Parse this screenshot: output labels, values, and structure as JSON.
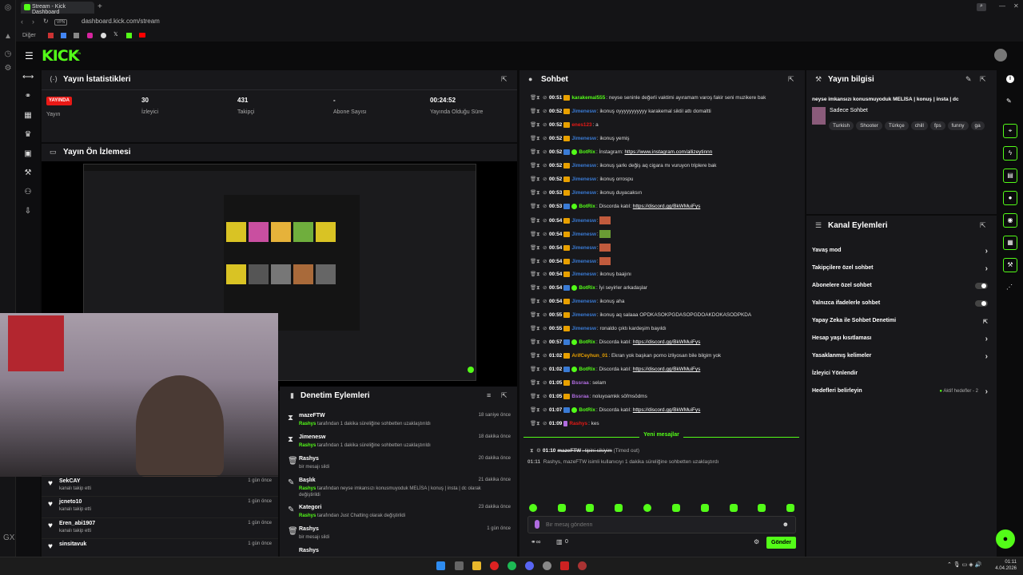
{
  "browser": {
    "tab_title": "Stream - Kick Dashboard",
    "url": "dashboard.kick.com/stream",
    "vpn": "VPN",
    "bookmarks_label": "Diğer"
  },
  "brand": {
    "logo": "KICK",
    "beta": "BETA",
    "accent": "#53fc18"
  },
  "stats": {
    "title": "Yayın İstatistikleri",
    "live_badge": "YAYINDA",
    "live_label": "Yayın",
    "viewers_val": "30",
    "viewers_lbl": "İzleyici",
    "followers_val": "431",
    "followers_lbl": "Takipçi",
    "subs_val": "-",
    "subs_lbl": "Abone Sayısı",
    "uptime_val": "00:24:52",
    "uptime_lbl": "Yayında Olduğu Süre"
  },
  "preview": {
    "title": "Yayın Ön İzlemesi"
  },
  "follows": [
    {
      "name": "SekCAY",
      "desc": "kanalı takip etti",
      "time": "1 gün önce"
    },
    {
      "name": "jcneto10",
      "desc": "kanalı takip etti",
      "time": "1 gün önce"
    },
    {
      "name": "Eren_abi1907",
      "desc": "kanalı takip etti",
      "time": "1 gün önce"
    },
    {
      "name": "sinsitavuk",
      "desc": "kanalı takip etti",
      "time": "1 gün önce"
    }
  ],
  "moderation": {
    "title": "Denetim Eylemleri",
    "rows": [
      {
        "name": "mazeFTW",
        "actor": "Rashys",
        "desc": " tarafından 1 dakika süreliğine sohbetten uzaklaştırıldı",
        "time": "18 saniye önce"
      },
      {
        "name": "Jimenesw",
        "actor": "Rashys",
        "desc": " tarafından 1 dakika süreliğine sohbetten uzaklaştırıldı",
        "time": "18 dakika önce"
      },
      {
        "name": "Rashys",
        "actor": "",
        "desc": "bir mesajı sildi",
        "time": "20 dakika önce"
      },
      {
        "name": "Başlık",
        "actor": "Rashys",
        "desc": " tarafından neyse imkansızı konusmuyoduk MELİSA | konuş | insta | dc olarak değiştirildi",
        "time": "21 dakika önce"
      },
      {
        "name": "Kategori",
        "actor": "Rashys",
        "desc": " tarafından Just Chatting olarak değiştirildi",
        "time": "23 dakika önce"
      },
      {
        "name": "Rashys",
        "actor": "",
        "desc": "bir mesajı sildi",
        "time": "1 gün önce"
      },
      {
        "name": "Rashys",
        "actor": "",
        "desc": "",
        "time": "1 gün önce"
      }
    ]
  },
  "chat": {
    "title": "Sohbet",
    "new_messages": "Yeni mesajlar",
    "placeholder": "Bir mesaj gönderin",
    "send": "Gönder",
    "count": "0",
    "messages": [
      {
        "ts": "00:51",
        "user": "karakemal555",
        "color": "#53fc18",
        "badge": "sub",
        "text": ": neyse seninle değerli vaktimi ayıramam varoş fakir seni muzikere bak"
      },
      {
        "ts": "00:52",
        "user": "Jimenesw",
        "color": "#3a7bd5",
        "badge": "sub",
        "text": ": ikonuş oyyyyyyyyyyy karakemal siktil attı domaltti"
      },
      {
        "ts": "00:52",
        "user": "enes123",
        "color": "#e91916",
        "badge": "sub",
        "text": ": a"
      },
      {
        "ts": "00:52",
        "user": "Jimenesw",
        "color": "#3a7bd5",
        "badge": "sub",
        "text": ": ikonuş yemiş"
      },
      {
        "ts": "00:52",
        "user": "BotRix",
        "color": "#53fc18",
        "badge": "bot",
        "text": ": İnstagram: ",
        "link": "https://www.instagram.com/allizeytinnn"
      },
      {
        "ts": "00:52",
        "user": "Jimenesw",
        "color": "#3a7bd5",
        "badge": "sub",
        "text": ": ikonuş şarkı değiş aq cigara mı vuruyon triplere bak"
      },
      {
        "ts": "00:52",
        "user": "Jimenesw",
        "color": "#3a7bd5",
        "badge": "sub",
        "text": ": ikonuş orrospu"
      },
      {
        "ts": "00:53",
        "user": "Jimenesw",
        "color": "#3a7bd5",
        "badge": "sub",
        "text": ": ikonuş duyacaksın"
      },
      {
        "ts": "00:53",
        "user": "BotRix",
        "color": "#53fc18",
        "badge": "bot",
        "text": ": Discorda katıl: ",
        "link": "https://discord.gg/BkWMuiFys"
      },
      {
        "ts": "00:54",
        "user": "Jimenesw",
        "color": "#3a7bd5",
        "badge": "sub",
        "text": ":",
        "emote": "red"
      },
      {
        "ts": "00:54",
        "user": "Jimenesw",
        "color": "#3a7bd5",
        "badge": "sub",
        "text": ":",
        "emote": "green"
      },
      {
        "ts": "00:54",
        "user": "Jimenesw",
        "color": "#3a7bd5",
        "badge": "sub",
        "text": ":",
        "emote": "red"
      },
      {
        "ts": "00:54",
        "user": "Jimenesw",
        "color": "#3a7bd5",
        "badge": "sub",
        "text": ":",
        "emote": "red"
      },
      {
        "ts": "00:54",
        "user": "Jimenesw",
        "color": "#3a7bd5",
        "badge": "sub",
        "text": ": ikonuş baajını"
      },
      {
        "ts": "00:54",
        "user": "BotRix",
        "color": "#53fc18",
        "badge": "bot",
        "text": ": İyi seyirler arkadaşlar"
      },
      {
        "ts": "00:54",
        "user": "Jimenesw",
        "color": "#3a7bd5",
        "badge": "sub",
        "text": ": ikonuş aha"
      },
      {
        "ts": "00:55",
        "user": "Jimenesw",
        "color": "#3a7bd5",
        "badge": "sub",
        "text": ": ikonuş aq salaaa OPDKASOKPGDASOPGDOAKDOKASODPKDA"
      },
      {
        "ts": "00:55",
        "user": "Jimenesw",
        "color": "#3a7bd5",
        "badge": "sub",
        "text": ": ronaldo çıktı kardeşim bayıldı"
      },
      {
        "ts": "00:57",
        "user": "BotRix",
        "color": "#53fc18",
        "badge": "bot",
        "text": ": Discorda katıl: ",
        "link": "https://discord.gg/BkWMuiFys"
      },
      {
        "ts": "01:02",
        "user": "ArifCeyhun_01",
        "color": "#e8a000",
        "badge": "sub",
        "text": ": Ekran yok başkan porno izliyosan bile bilgim yok"
      },
      {
        "ts": "01:02",
        "user": "BotRix",
        "color": "#53fc18",
        "badge": "bot",
        "text": ": Discorda katıl: ",
        "link": "https://discord.gg/BkWMuiFys"
      },
      {
        "ts": "01:05",
        "user": "Bssraa",
        "color": "#b06ce0",
        "badge": "sub",
        "text": ": selam"
      },
      {
        "ts": "01:05",
        "user": "Bssraa",
        "color": "#b06ce0",
        "badge": "sub",
        "text": ": noluyoamkk söfmsödms"
      },
      {
        "ts": "01:07",
        "user": "BotRix",
        "color": "#53fc18",
        "badge": "bot",
        "text": ": Discorda katıl: ",
        "link": "https://discord.gg/BkWMuiFys"
      },
      {
        "ts": "01:09",
        "user": "Rashys",
        "color": "#e91916",
        "badge": "mod",
        "text": ": kes"
      }
    ],
    "timeout_line": {
      "ts": "01:10",
      "user": "mazeFTW",
      "text": ": tipini sikiyim",
      "tag": "(Timed out)"
    },
    "system_line": {
      "ts": "01:11",
      "text": "Rashys, mazeFTW isimli kullanıcıyı 1 dakika süreliğine sohbetten uzaklaştırdı"
    }
  },
  "stream_info": {
    "title": "Yayın bilgisi",
    "stream_title": "neyse imkansızı konusmuyoduk MELİSA | konuş | insta | dc",
    "category": "Sadece Sohbet",
    "tags": [
      "Turkish",
      "Shooter",
      "Türkçe",
      "chill",
      "fps",
      "funny",
      "ga"
    ]
  },
  "channel_actions": {
    "title": "Kanal Eylemleri",
    "rows": [
      {
        "label": "Yavaş mod",
        "kind": "arrow"
      },
      {
        "label": "Takipçilere özel sohbet",
        "kind": "arrow"
      },
      {
        "label": "Abonelere özel sohbet",
        "kind": "toggle"
      },
      {
        "label": "Yalnızca ifadelerle sohbet",
        "kind": "toggle"
      },
      {
        "label": "Yapay Zeka ile Sohbet Denetimi",
        "kind": "ext"
      },
      {
        "label": "Hesap yaşı kısıtlaması",
        "kind": "arrow"
      },
      {
        "label": "Yasaklanmış kelimeler",
        "kind": "arrow"
      },
      {
        "label": "İzleyici Yönlendir",
        "kind": "none"
      },
      {
        "label": "Hedefleri belirleyin",
        "kind": "goal",
        "extra": "Aktif hedefler - 2"
      }
    ]
  },
  "taskbar": {
    "time": "01:11",
    "date": "4.04.2026"
  },
  "icons": {
    "menu": "menu-icon",
    "chat": "chat-icon",
    "info": "info-icon",
    "wrench": "wrench-icon",
    "external": "external-link-icon",
    "heart": "heart-icon",
    "trash": "trash-icon",
    "send": "send-icon"
  }
}
